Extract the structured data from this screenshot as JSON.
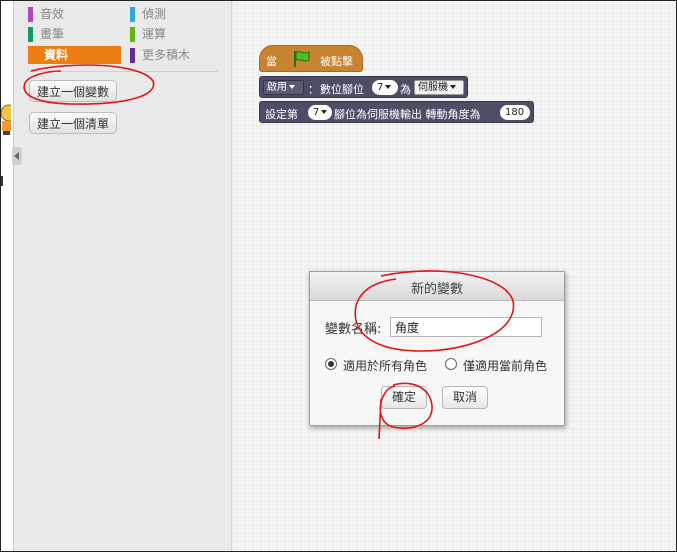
{
  "palette": {
    "categories": [
      {
        "label": "音效",
        "color": "#bb42c3"
      },
      {
        "label": "偵測",
        "color": "#2ca5e2"
      },
      {
        "label": "畫筆",
        "color": "#0e9a6c"
      },
      {
        "label": "運算",
        "color": "#5cb712"
      },
      {
        "label": "資料",
        "color": "#ee7d16",
        "selected": true
      },
      {
        "label": "更多積木",
        "color": "#632d99"
      }
    ],
    "make_variable": "建立一個變數",
    "make_list": "建立一個清單"
  },
  "scripts": {
    "hat_when": "當",
    "hat_clicked": "被點擊",
    "block1": {
      "mode": "啟用",
      "colon": "：",
      "pin_label": "數位腳位",
      "pin": "7",
      "as": "為",
      "type": "伺服機"
    },
    "block2": {
      "set": "設定第",
      "pin": "7",
      "rest": "腳位為伺服機輸出 轉動角度為",
      "angle": "180"
    }
  },
  "dialog": {
    "title": "新的變數",
    "name_label": "變數名稱:",
    "name_value": "角度",
    "option_all": "適用於所有角色",
    "option_this": "僅適用當前角色",
    "ok": "確定",
    "cancel": "取消"
  }
}
